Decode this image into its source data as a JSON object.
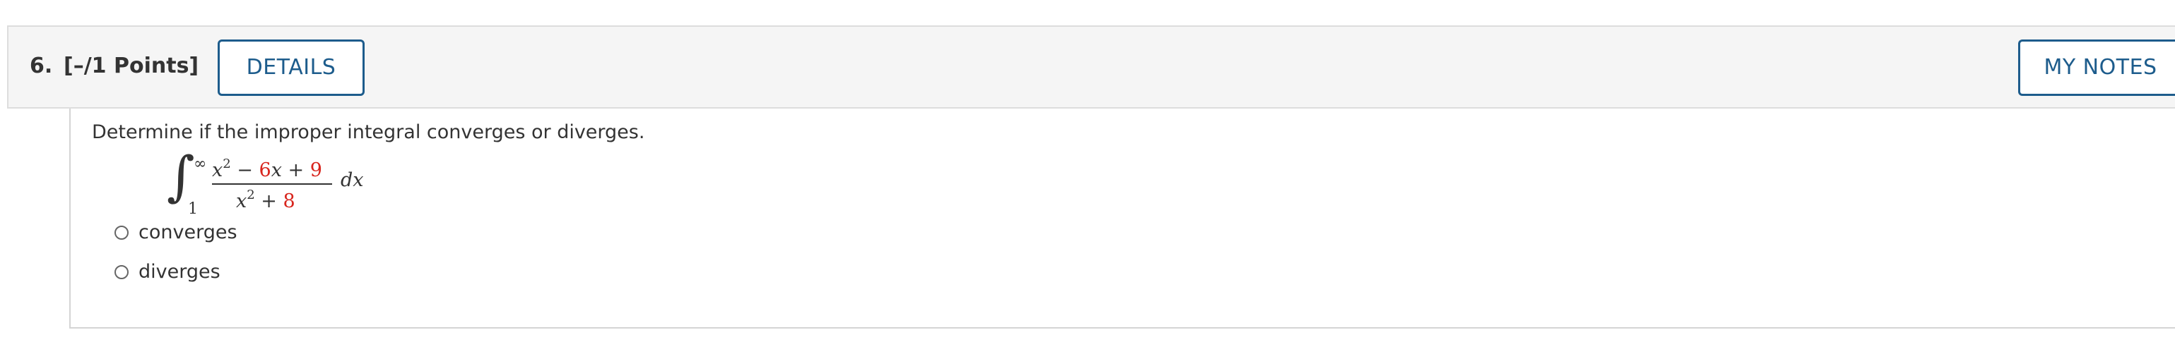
{
  "question": {
    "number": "6.",
    "points": "[–/1 Points]",
    "details_label": "DETAILS",
    "notes_label": "MY NOTES",
    "prompt": "Determine if the improper integral converges or diverges."
  },
  "integral": {
    "upper_limit": "∞",
    "lower_limit": "1",
    "numerator": {
      "x_var": "x",
      "exponent": "2",
      "minus": "−",
      "coef_b": "6",
      "x_var_2": "x",
      "plus": "+",
      "const": "9"
    },
    "denominator": {
      "x_var": "x",
      "exponent": "2",
      "plus": "+",
      "const": "8"
    },
    "differential": "dx"
  },
  "options": [
    {
      "label": "converges",
      "selected": false
    },
    {
      "label": "diverges",
      "selected": false
    }
  ],
  "colors": {
    "accent": "#1d5c8c",
    "highlight_red": "#d8251d",
    "text": "#333333"
  }
}
